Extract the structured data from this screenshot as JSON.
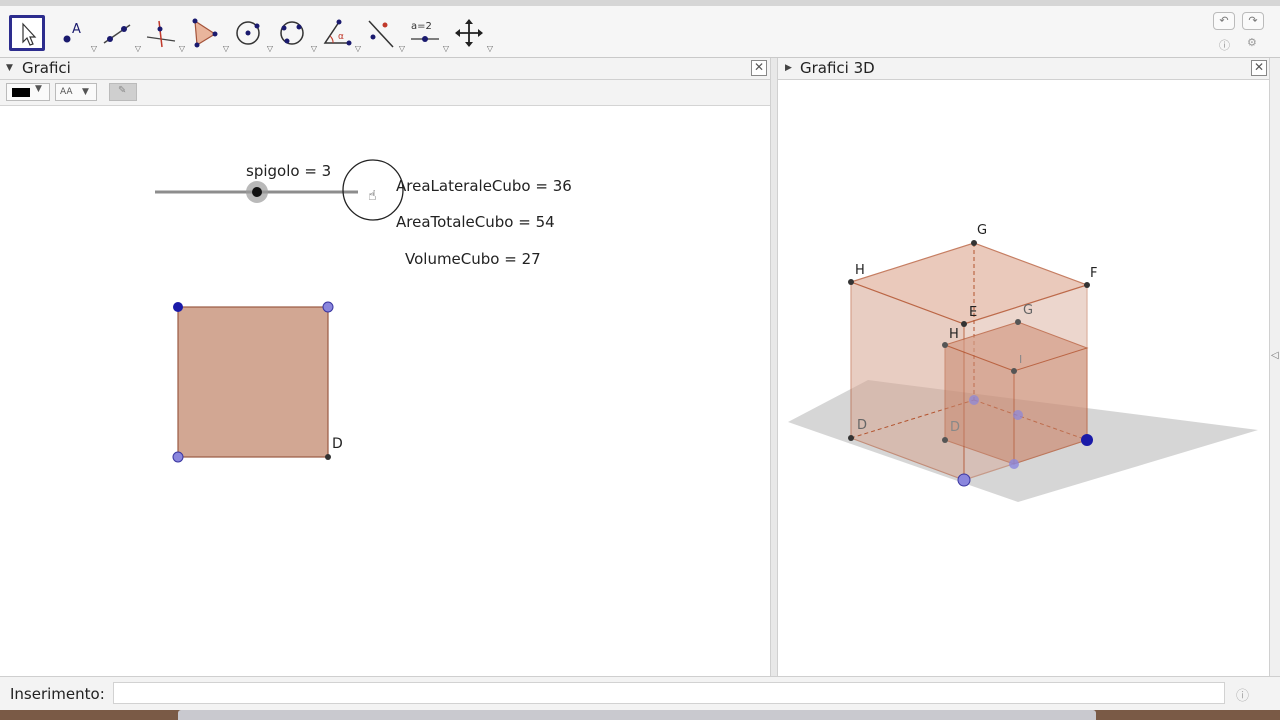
{
  "panels": {
    "graphics_title": "Grafici",
    "graphics3d_title": "Grafici 3D"
  },
  "slider": {
    "label": "spigolo = 3",
    "value": 3
  },
  "texts": {
    "lateral": "AreaLateraleCubo = 36",
    "total": "AreaTotaleCubo = 54",
    "volume": "VolumeCubo = 27"
  },
  "square": {
    "vertex_label": "D",
    "fill_color": "#d2a793"
  },
  "cube": {
    "labels": {
      "g_top": "G",
      "h_top": "H",
      "f_top": "F",
      "e_top": "E",
      "h_inner": "H",
      "g_inner": "G",
      "d_left": "D",
      "d_inner": "D",
      "i_inner": "I"
    }
  },
  "input": {
    "label": "Inserimento:",
    "value": ""
  },
  "icons": [
    "move-arrow-icon",
    "point-icon",
    "line-icon",
    "perpendicular-icon",
    "polygon-icon",
    "circle-icon",
    "conic-icon",
    "angle-icon",
    "reflect-icon",
    "slider-tool-icon",
    "move-view-icon",
    "undo-icon",
    "redo-icon",
    "help-icon",
    "settings-icon"
  ],
  "colors": {
    "selection": "#2d2d8e",
    "point_dark": "#1a1aa8",
    "point_light": "#8a86dd",
    "cube_edge": "#b3532e"
  }
}
